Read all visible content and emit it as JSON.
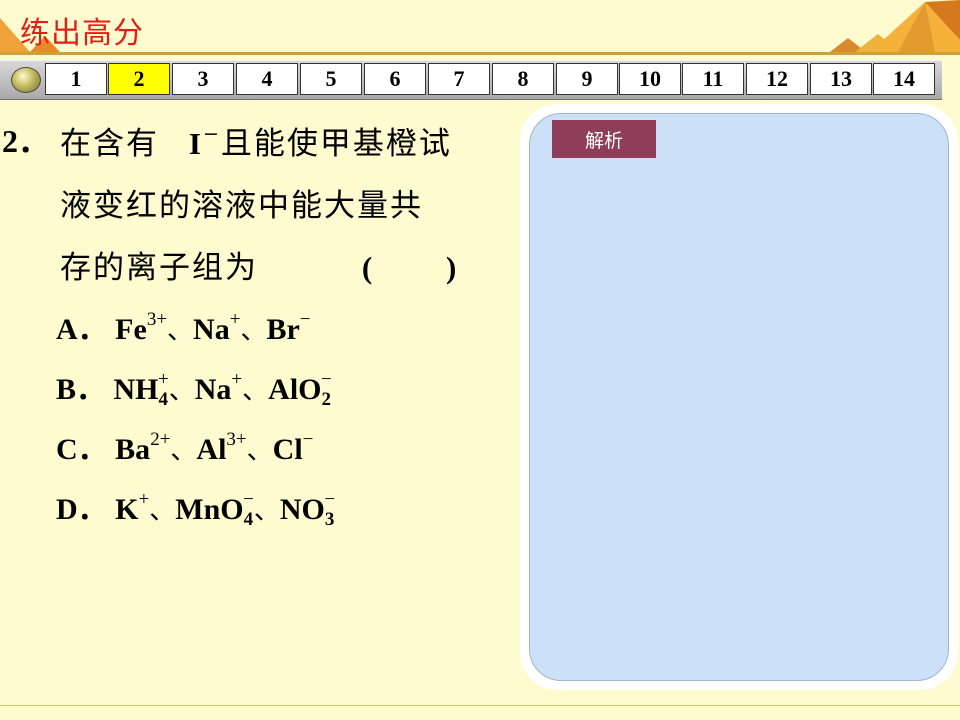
{
  "header": {
    "title": "练出高分"
  },
  "nav": {
    "pages": [
      "1",
      "2",
      "3",
      "4",
      "5",
      "6",
      "7",
      "8",
      "9",
      "10",
      "11",
      "12",
      "13",
      "14"
    ],
    "active_index": 1
  },
  "question": {
    "number": "2．",
    "line1_a": "在含有",
    "line1_ion": "I",
    "line1_sup": "−",
    "line1_b": "且能使甲基橙试",
    "line2": "液变红的溶液中能大量共",
    "line3": "存的离子组为",
    "paren_open": "(",
    "paren_close": ")",
    "options": {
      "A": {
        "label": "A．",
        "i1": "Fe",
        "i1_sup": "3+",
        "sep1": "、",
        "i2": "Na",
        "i2_sup": "+",
        "sep2": "、",
        "i3": "Br",
        "i3_sup": "−"
      },
      "B": {
        "label": "B．",
        "i1": "NH",
        "i1_sub": "4",
        "i1_sup": "+",
        "sep1": "、",
        "i2": "Na",
        "i2_sup": "+",
        "sep2": "、",
        "i3": "AlO",
        "i3_sub": "2",
        "i3_sup": "−"
      },
      "C": {
        "label": "C．",
        "i1": "Ba",
        "i1_sup": "2+",
        "sep1": "、",
        "i2": "Al",
        "i2_sup": "3+",
        "sep2": "、",
        "i3": "Cl",
        "i3_sup": "−"
      },
      "D": {
        "label": "D．",
        "i1": "K",
        "i1_sup": "+",
        "sep1": "、",
        "i2": "MnO",
        "i2_sub": "4",
        "i2_sup": "−",
        "sep2": "、",
        "i3": "NO",
        "i3_sub": "3",
        "i3_sup": "−"
      }
    }
  },
  "analysis": {
    "label": "解析"
  },
  "colors": {
    "background": "#fdfbcf",
    "title": "#e21f15",
    "active_tab": "#ffff00",
    "analysis_label": "#8f3d59",
    "panel": "#cce1f8"
  }
}
